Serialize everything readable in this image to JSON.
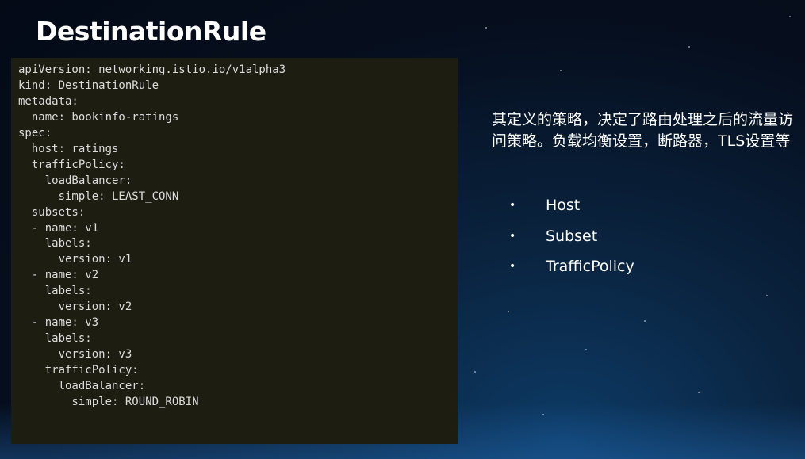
{
  "slide": {
    "title": "DestinationRule",
    "code_lines": [
      "apiVersion: networking.istio.io/v1alpha3",
      "kind: DestinationRule",
      "metadata:",
      "  name: bookinfo-ratings",
      "spec:",
      "  host: ratings",
      "  trafficPolicy:",
      "    loadBalancer:",
      "      simple: LEAST_CONN",
      "  subsets:",
      "  - name: v1",
      "    labels:",
      "      version: v1",
      "  - name: v2",
      "    labels:",
      "      version: v2",
      "  - name: v3",
      "    labels:",
      "      version: v3",
      "    trafficPolicy:",
      "      loadBalancer:",
      "        simple: ROUND_ROBIN"
    ],
    "description": "其定义的策略，决定了路由处理之后的流量访问策略。负载均衡设置，断路器，TLS设置等",
    "bullet_marker": "•",
    "bullets": [
      "Host",
      "Subset",
      "TrafficPolicy"
    ]
  }
}
